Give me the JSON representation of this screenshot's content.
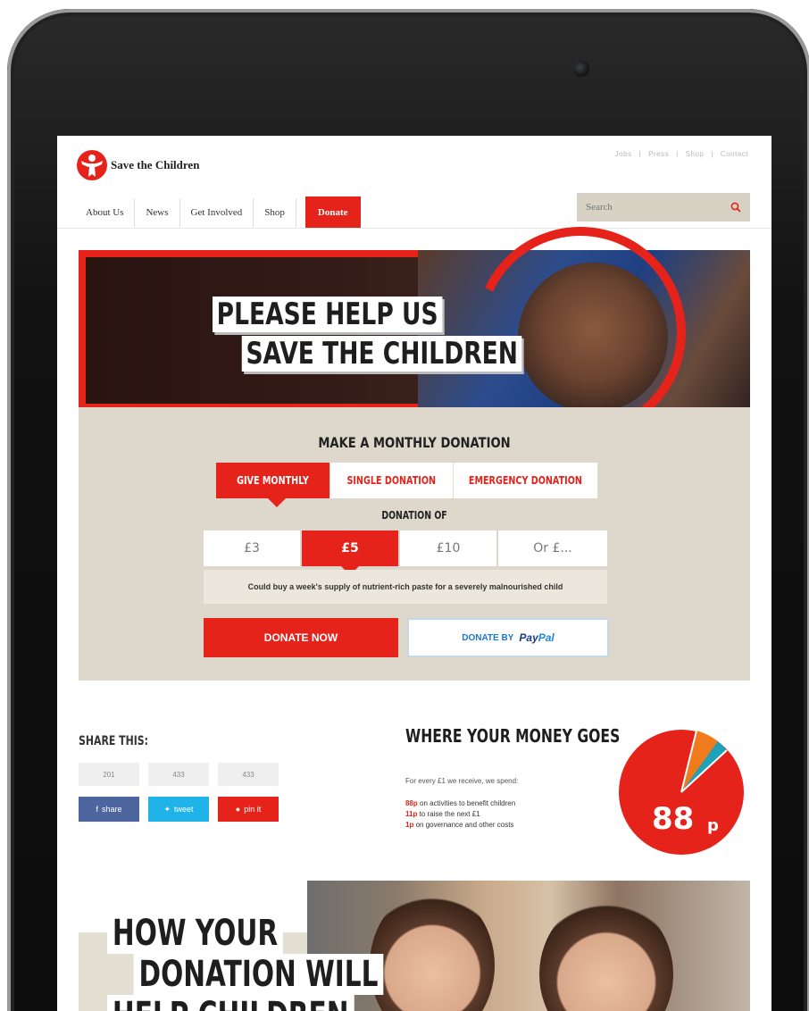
{
  "brand": {
    "name": "Save the Children",
    "accent": "#e5231b"
  },
  "header": {
    "top_links": [
      "Jobs",
      "Press",
      "Shop",
      "Contact"
    ],
    "nav": [
      "About Us",
      "News",
      "Get Involved",
      "Shop"
    ],
    "donate_label": "Donate",
    "search_placeholder": "Search"
  },
  "hero": {
    "line1": "PLEASE HELP US",
    "line2": "SAVE THE CHILDREN"
  },
  "donation": {
    "title": "MAKE A MONTHLY DONATION",
    "tabs": [
      "GIVE MONTHLY",
      "SINGLE DONATION",
      "EMERGENCY DONATION"
    ],
    "donation_of": "DONATION OF",
    "amounts": [
      "£3",
      "£5",
      "£10",
      "Or £..."
    ],
    "selected_amount": "£5",
    "note": "Could buy a week's supply of nutrient-rich paste for a severely malnourished child",
    "donate_now": "DONATE NOW",
    "donate_by": "DONATE BY",
    "paypal": {
      "p1": "Pay",
      "p2": "Pal"
    }
  },
  "share": {
    "title": "SHARE THIS:",
    "counts": [
      "201",
      "433",
      "433"
    ],
    "buttons": [
      "share",
      "tweet",
      "pin it"
    ]
  },
  "money": {
    "title": "WHERE YOUR MONEY GOES",
    "intro": "For every £1 we receive, we spend:",
    "lines": [
      {
        "amount": "88p",
        "text": " on activities to benefit children"
      },
      {
        "amount": "11p",
        "text": " to raise the next £1"
      },
      {
        "amount": "1p",
        "text": " on governance and other costs"
      }
    ],
    "big_value": "88",
    "big_unit": "p",
    "pie_colors": [
      "#e5231b",
      "#f07b1d",
      "#1ea2b8",
      "#7c7c7c"
    ]
  },
  "bottom": {
    "line1": "HOW YOUR",
    "line2": "DONATION WILL",
    "line3": "HELP CHILDREN"
  }
}
